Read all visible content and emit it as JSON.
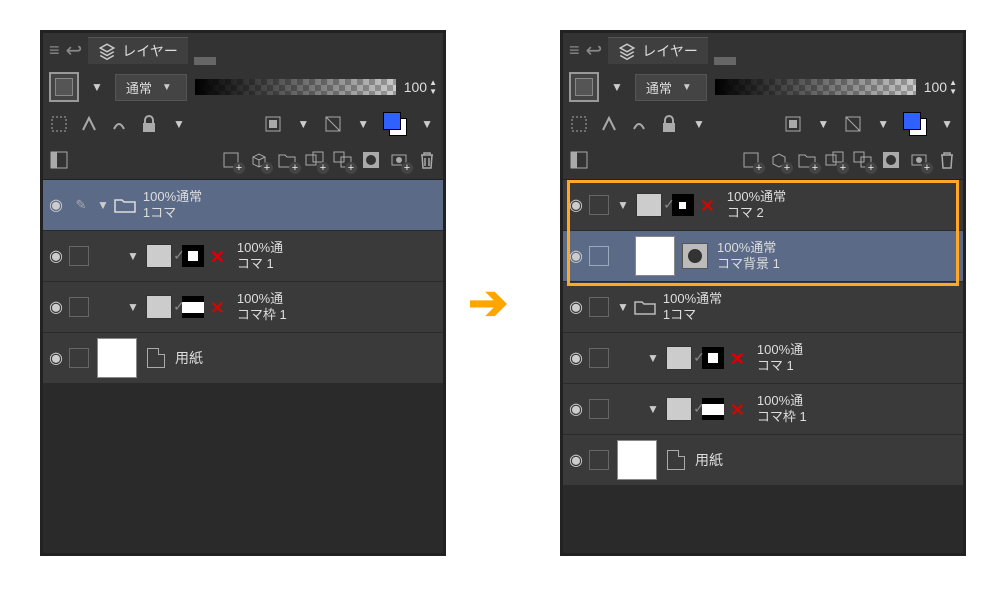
{
  "tab_label": "レイヤー",
  "blend_mode": "通常",
  "opacity_value": "100",
  "left": {
    "folder": {
      "line1": "100%通常",
      "line2": "1コマ"
    },
    "frame1": {
      "line1": "100%通",
      "line2": "コマ 1"
    },
    "frame2": {
      "line1": "100%通",
      "line2": "コマ枠 1"
    },
    "paper": {
      "label": "用紙"
    }
  },
  "right": {
    "new1": {
      "line1": "100%通常",
      "line2": "コマ 2"
    },
    "new2": {
      "line1": "100%通常",
      "line2": "コマ背景 1"
    },
    "folder": {
      "line1": "100%通常",
      "line2": "1コマ"
    },
    "frame1": {
      "line1": "100%通",
      "line2": "コマ 1"
    },
    "frame2": {
      "line1": "100%通",
      "line2": "コマ枠 1"
    },
    "paper": {
      "label": "用紙"
    }
  }
}
